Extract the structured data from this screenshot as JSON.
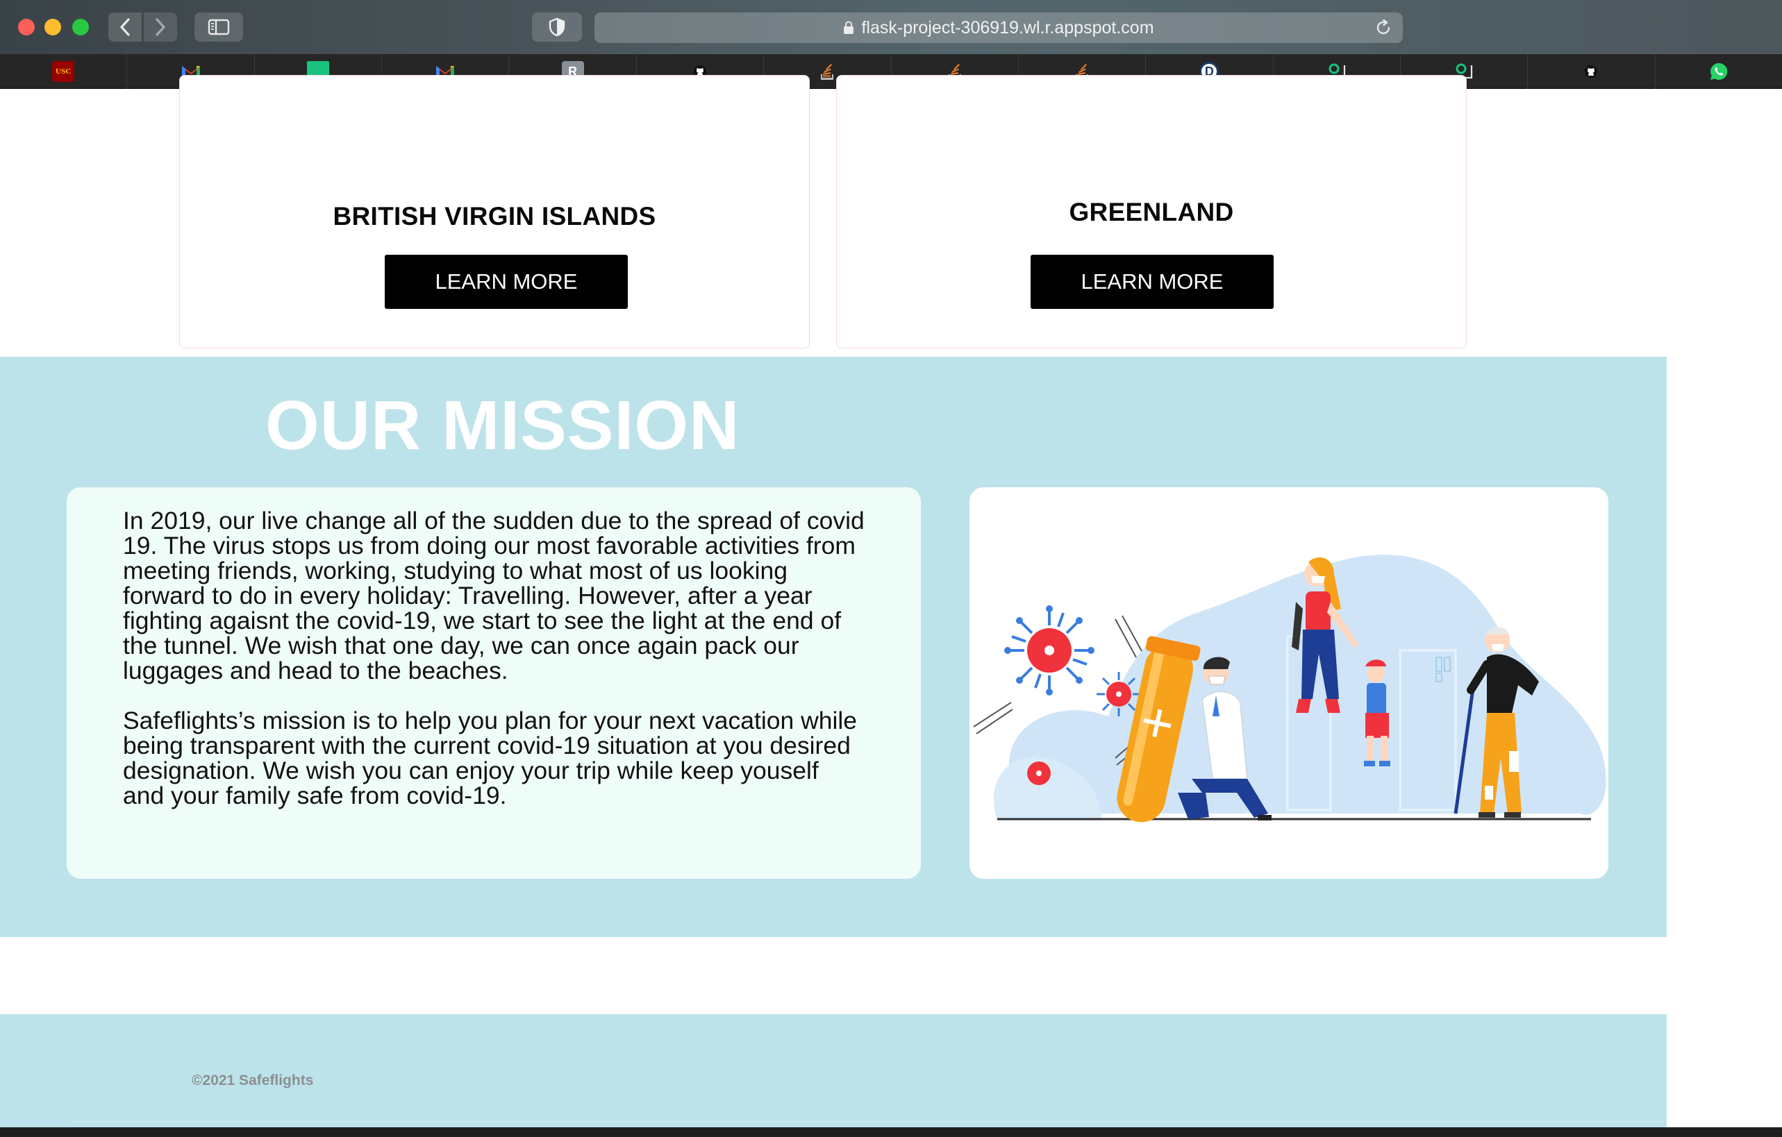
{
  "browser": {
    "url": "flask-project-306919.wl.r.appspot.com",
    "bookmarks": [
      {
        "icon": "usc-icon",
        "label": "USC",
        "bg": "#990000",
        "fg": "#ffcc00"
      },
      {
        "icon": "gmail-icon",
        "label": "",
        "bg": "transparent",
        "fg": "#ea4335"
      },
      {
        "icon": "green-square-icon",
        "label": "",
        "bg": "#19c37d",
        "fg": "#19c37d"
      },
      {
        "icon": "gmail-icon",
        "label": "",
        "bg": "transparent",
        "fg": "#ea4335"
      },
      {
        "icon": "r-icon",
        "label": "R",
        "bg": "#8a8f98",
        "fg": "#ffffff"
      },
      {
        "icon": "github-icon",
        "label": "",
        "bg": "#ffffff",
        "fg": "#111111"
      },
      {
        "icon": "stack-icon",
        "label": "",
        "bg": "transparent",
        "fg": "#f48024"
      },
      {
        "icon": "stack-icon",
        "label": "",
        "bg": "transparent",
        "fg": "#f48024"
      },
      {
        "icon": "stack-icon",
        "label": "",
        "bg": "transparent",
        "fg": "#f48024"
      },
      {
        "icon": "d-icon",
        "label": "D",
        "bg": "#ffffff",
        "fg": "#1b3a63"
      },
      {
        "icon": "o-icon",
        "label": "",
        "bg": "transparent",
        "fg": "#19c37d"
      },
      {
        "icon": "o-icon",
        "label": "",
        "bg": "transparent",
        "fg": "#19c37d"
      },
      {
        "icon": "github-icon",
        "label": "",
        "bg": "#ffffff",
        "fg": "#111111"
      },
      {
        "icon": "whatsapp-icon",
        "label": "",
        "bg": "#25d366",
        "fg": "#ffffff"
      }
    ]
  },
  "cards": [
    {
      "title": "BRITISH VIRGIN ISLANDS",
      "button": "LEARN MORE"
    },
    {
      "title": "GREENLAND",
      "button": "LEARN MORE"
    }
  ],
  "mission": {
    "title": "OUR MISSION",
    "paragraph1": "In 2019, our live change all of the sudden due to the spread of covid 19. The virus stops us from doing our most favorable activities from meeting friends, working, studying to what most of us looking forward to do in every holiday: Travelling. However, after a year fighting agaisnt the covid-19, we start to see the light at the end of the tunnel. We wish that one day, we can once again pack our luggages and head to the beaches.",
    "paragraph2": "Safeflights’s mission is to help you plan for your next vacation while being transparent with the current covid-19 situation at you desired designation. We wish you can enjoy your trip while keep youself and your family safe from covid-19."
  },
  "footer": {
    "copyright": "©2021 Safeflights"
  },
  "colors": {
    "mission_bg": "#bde3ea",
    "text_box_bg": "#effdf9",
    "button_bg": "#000000",
    "virus_red": "#f0323c",
    "virus_blue": "#3b7ddd",
    "illustration_blue": "#cfe5f7",
    "tube_orange": "#f7a21b"
  }
}
